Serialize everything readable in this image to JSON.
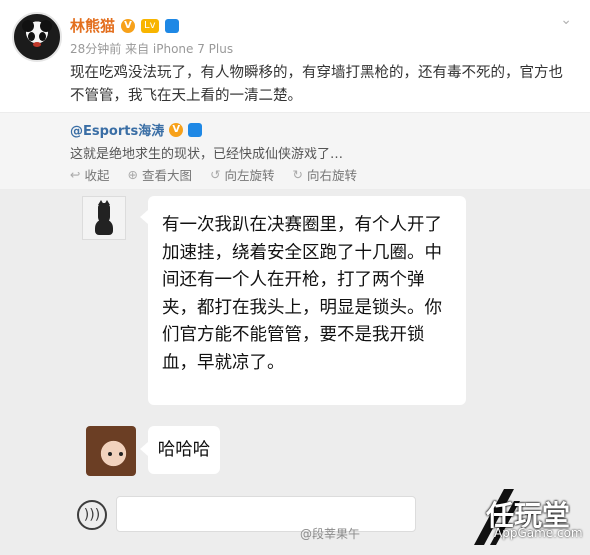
{
  "post": {
    "username": "林熊猫",
    "level_badge": "Lv",
    "meta": "28分钟前 来自 iPhone 7 Plus",
    "content": "现在吃鸡没法玩了，有人物瞬移的，有穿墙打黑枪的，还有毒不死的，官方也不管管，我飞在天上看的一清二楚。",
    "more_icon": "chevron-down-icon"
  },
  "repost": {
    "user": "@Esports海涛",
    "text": "这就是绝地求生的现状，已经快成仙侠游戏了…",
    "actions": [
      {
        "label": "收起",
        "icon": "collapse-icon"
      },
      {
        "label": "查看大图",
        "icon": "zoom-icon"
      },
      {
        "label": "向左旋转",
        "icon": "rotate-left-icon"
      },
      {
        "label": "向右旋转",
        "icon": "rotate-right-icon"
      }
    ]
  },
  "chat": {
    "message1": "有一次我趴在决赛圈里，有个人开了加速挂，绕着安全区跑了十几圈。中间还有一个人在开枪，打了两个弹夹，都打在我头上，明显是锁头。你们官方能不能管管，要不是我开锁血，早就凉了。",
    "message2": "哈哈哈",
    "input_placeholder": ""
  },
  "watermarks": {
    "weibo": "@段莘果午",
    "logo": "任玩堂",
    "logo_sub": "AppGame.com"
  }
}
